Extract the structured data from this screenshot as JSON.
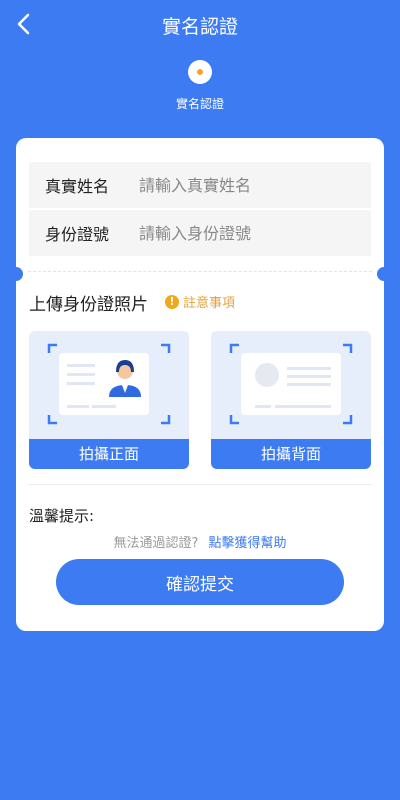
{
  "header": {
    "title": "實名認證",
    "back_icon": "chevron-left-icon"
  },
  "progress": {
    "step_label": "實名認證",
    "active_color": "#f5a623"
  },
  "form": {
    "name_label": "真實姓名",
    "name_placeholder": "請輸入真實姓名",
    "id_label": "身份證號",
    "id_placeholder": "請輸入身份證號"
  },
  "upload": {
    "title": "上傳身份證照片",
    "notice": "註意事項",
    "front_button": "拍攝正面",
    "back_button": "拍攝背面"
  },
  "tips": {
    "title": "溫馨提示:",
    "question": "無法通過認證?",
    "link": "點擊獲得幫助"
  },
  "submit_label": "確認提交",
  "colors": {
    "primary": "#3d7bf2",
    "warning": "#e6a23c"
  }
}
